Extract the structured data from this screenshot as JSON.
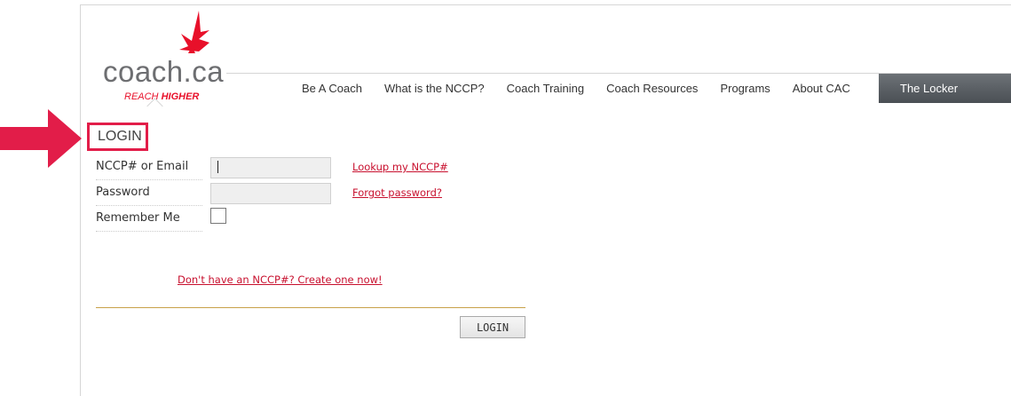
{
  "brand": {
    "logo_text": "coach.ca",
    "tagline_normal": "REACH ",
    "tagline_bold": "HIGHER",
    "accent_color": "#e8102a"
  },
  "nav": {
    "items": [
      "Be A Coach",
      "What is the NCCP?",
      "Coach Training",
      "Coach Resources",
      "Programs",
      "About CAC"
    ],
    "highlight": "The Locker"
  },
  "login": {
    "title": "LOGIN",
    "fields": {
      "nccp_label": "NCCP# or Email",
      "nccp_value": "",
      "password_label": "Password",
      "password_value": "",
      "remember_label": "Remember Me"
    },
    "links": {
      "lookup": "Lookup my NCCP#",
      "forgot": "Forgot password?",
      "create": "Don't have an NCCP#? Create one now!"
    },
    "submit_label": "LOGIN"
  },
  "annotation": {
    "arrow_color": "#e21d49"
  }
}
